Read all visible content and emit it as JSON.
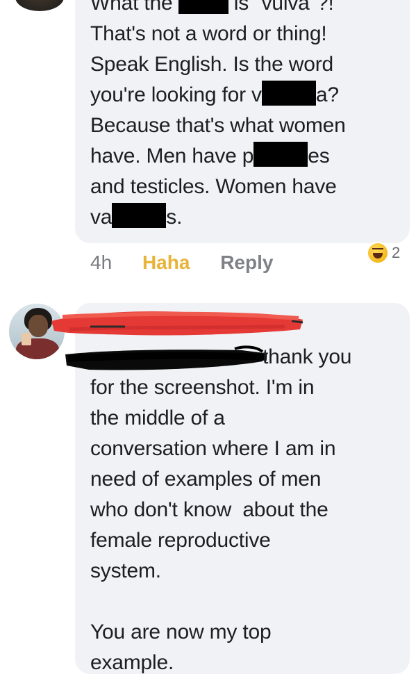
{
  "comment1": {
    "lines": [
      {
        "pre": "What the ",
        "post": " is \"vulva\"?!"
      },
      {
        "text": "That's not a word or thing!"
      },
      {
        "text": "Speak English. Is the word"
      },
      {
        "pre": "you're looking for v",
        "post": "a?"
      },
      {
        "text": "Because that's what women"
      },
      {
        "pre": "have. Men have p",
        "post": "es"
      },
      {
        "text": "and testicles. Women have"
      },
      {
        "pre": "va",
        "post": "s."
      }
    ],
    "time": "4h",
    "reaction_label": "Haha",
    "reply_label": "Reply",
    "reaction_count": "2",
    "reaction_icon": "laughing-emoji-icon"
  },
  "comment2": {
    "lines": [
      {
        "post": "thank you"
      },
      {
        "text": "for the screenshot. I'm in"
      },
      {
        "text": "the middle of a"
      },
      {
        "text": "conversation where I am in"
      },
      {
        "text": "need of examples of men"
      },
      {
        "text": "who don't know  about the"
      },
      {
        "text": "female reproductive"
      },
      {
        "text": "system."
      },
      {
        "text": ""
      },
      {
        "text": "You are now my top"
      },
      {
        "text": "example."
      }
    ]
  },
  "colors": {
    "bubble": "#f0f2f5",
    "text": "#1c1e21",
    "haha": "#e8b339",
    "meta": "#7f8186",
    "redaction": "#000000",
    "scribble_red": "#e53935"
  }
}
